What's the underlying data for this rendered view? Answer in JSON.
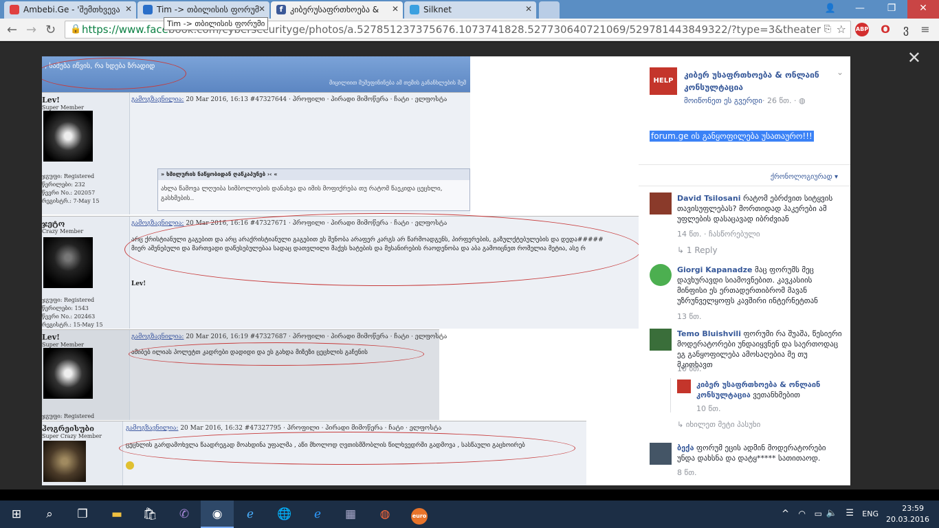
{
  "browser": {
    "tabs": [
      {
        "title": "Ambebi.Ge - 'შემთხვევა",
        "icon": "ambebi-icon",
        "color": "#e04040"
      },
      {
        "title": "Tim -> თბილისის ფორუმ",
        "icon": "forum-icon",
        "color": "#2a6fc9"
      },
      {
        "title": "კიბერუსაფრთხოება &",
        "icon": "facebook-icon",
        "color": "#3b5998",
        "active": true
      },
      {
        "title": "Silknet",
        "icon": "silknet-icon",
        "color": "#3aa0e0"
      }
    ],
    "url_secure": "https://www.face",
    "url_rest": "book.com/cybersecurityge/photos/a.527851237375676.1073741828.527730640721069/529781443849322/?type=3&theater",
    "tooltip": "Tim -> თბილისის ფორუმი",
    "window_controls": [
      "—",
      "❐",
      "✕"
    ]
  },
  "photo": {
    "forum_header_title": ", ხამება იწვის, რა ხდება ზრადიდ",
    "forum_header_sub": "მიცილიით მუშეფინინება ამ თემის განანხლების შემ",
    "posts": [
      {
        "user": "Lev!",
        "rank": "Super Member",
        "info": "ჯგუფი: Registered\nწერილები: 232\nწევრი No.: 202057\nრეგისტრ.: 7-May 15",
        "header_author": "გამოგზავნილია:",
        "header_meta": " 20 Mar 2016, 16:13  #47327644     · პროფილი · პირადი მიმოწერა · ჩატი · ელფოსტა",
        "quote_title": "» ხმილურის ნაწყობიდან ღაწკაპუნებ ›‹ «",
        "quote_text": "ახლა წამოვა ლღუიბა სიმბოლოების დანახვა და იმის მოფიქრება თუ რატომ წაეკიდა ცეცხლი,\nგასხმების.."
      },
      {
        "user": "ჯეტო",
        "rank": "Crazy Member",
        "info": "ჯგუფი: Registered\nწერილები: 1543\nწევრი No.: 202463\nრეგისტრ.: 15-May 15",
        "header_author": "გამოგზავნილია:",
        "header_meta": " 20 Mar 2016, 16:16  #47327671     · პროფილი · პირადი მიმოწერა · ჩატი · ელფოსტა",
        "body": "არც ქრისტიანული გაგებით და არც არაქრისტიანული გაგებით ეს შენობა არაფერ კარგს არ წარმოადგენს, პირფერების, გაზულქტებულების და დედა#####\nმიერ აშენებული და მართვადი დაწესებულებაა სადაც დათვლილი მაქვს ხატების და მესანირების რაოდენობა და აბა გამოიცნეთ რომელია მეტია, ასე რ",
        "sign": "Lev!"
      },
      {
        "user": "Lev!",
        "rank": "Super Member",
        "info": "ჯგუფი: Registered",
        "header_author": "გამოგზავნილია:",
        "header_meta": " 20 Mar 2016, 16:19  #47327687     · პროფილი · პირადი მიმოწერა · ჩატი · ელფოსტა",
        "body": "ამიბებ ილიას პოლეტთ კადრები დადიდი და ეს გახდა მიზეზი ცეცხლის გაჩენის"
      },
      {
        "user": "ჰოგრეისუბი",
        "rank": "Super Crazy Member",
        "header_author": "გამოგზავნილია:",
        "header_meta": " 20 Mar 2016, 16:32  #47327795     · პროფილი · პირადი მიმოწერა · ჩატი · ელფოსტა",
        "body": "ცეცხლის გარდამოხვლა წაადრეგად მოახდინა უფალმა , აწი მხოლოდ ღვთისმშობლის წილხვედრში გადმოვა , სასწაული გაცხოირებ"
      }
    ]
  },
  "panel": {
    "page_name": "კიბერ უსაფრთხოება & ონლაინ კონსულტაცია",
    "like_page": "მოიწონეთ ეს გვერდი",
    "time": "· 26 წთ. · ",
    "caption": "forum.ge ის განყოფილება უსათაურო!!!",
    "sort": "ქრონოლოგიურად ▾",
    "comments": [
      {
        "name": "David Tsilosani",
        "text": "რატომ ებრძვით სიტყვის თავისუფლებას? მორთიდად ჰაკერები ამ უფლების დასაცავად იბრძვიან",
        "time": "14 წთ.",
        "extra": " · ჩასწორებული",
        "reply": "↳ 1 Reply",
        "avatar_color": "#8a3a2a"
      },
      {
        "name": "Giorgi Kapanadze",
        "text": "მაც ფორუმს მეც დავხურავდი სიამოვნებით. კავკასიის მინფისი ეს ერთადერთიბრომ მავან უზრუნველყოფს კავშირი ინტერნეტთან",
        "time": "13 წთ.",
        "avatar_color": "#4caf50"
      },
      {
        "name": "Temo Bluishvili",
        "text": "ფორუმი რა შუაშა, წესიერი მოდერატორები უნდაიყვნენ და საერთოდაც ეგ განყოფილება ამოსაღებია მე თუ მკითხავთ",
        "time": "10 წთ.",
        "avatar_color": "#3a6e3a"
      },
      {
        "name": "კიბერ უსაფრთხოება & ონლაინ კონსულტაცია",
        "text": "ვეთანხმებით",
        "time": "10 წთ.",
        "avatar_color": "#c4352b"
      },
      {
        "name": "ბექა",
        "text": "ფორუმ ეცის ადმინ მოდერატორები უნდა დახსნა და დატყ***** სათითაოდ.",
        "time": "8 წთ.",
        "avatar_color": "#445566"
      }
    ],
    "more_replies": "↳ იხილეთ მეტი პასუხი"
  },
  "taskbar": {
    "lang": "ENG",
    "time": "23:59",
    "date": "20.03.2016"
  }
}
